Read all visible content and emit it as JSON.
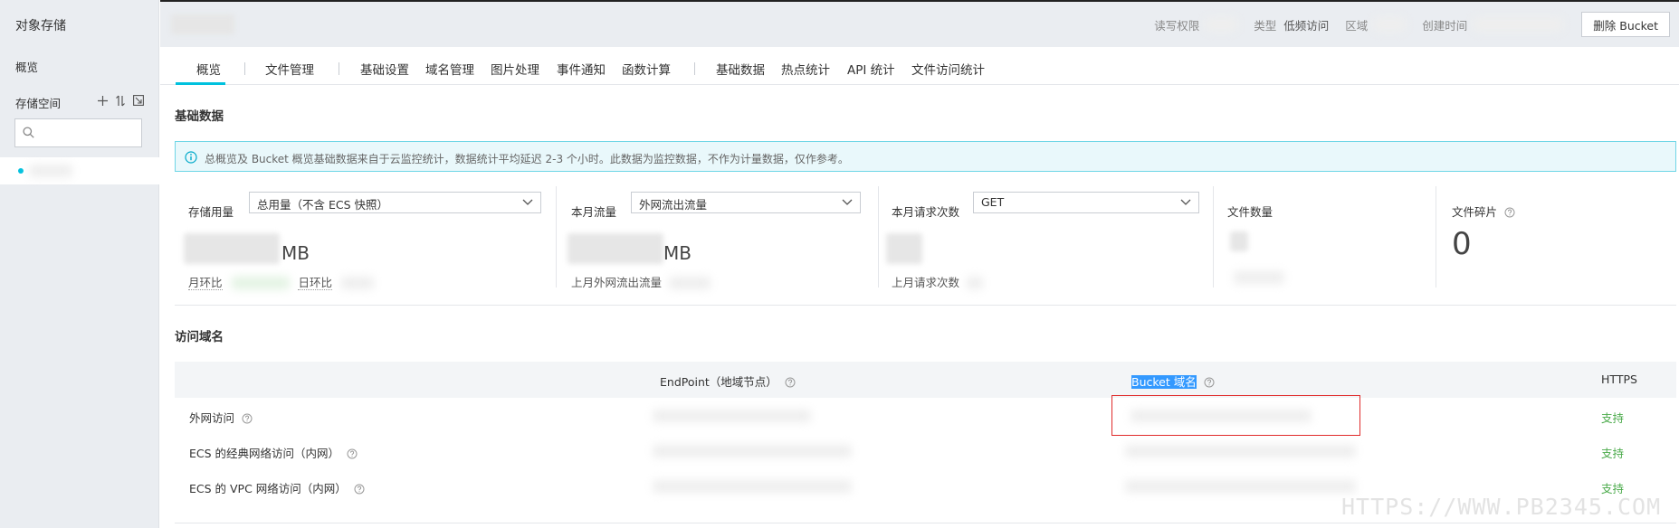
{
  "sidebar": {
    "title": "对象存储",
    "overview": "概览",
    "buckets_label": "存储空间",
    "search_placeholder": ""
  },
  "header": {
    "permission_label": "读写权限",
    "type_label": "类型",
    "type_value": "低频访问",
    "region_label": "区域",
    "created_label": "创建时间",
    "delete_button": "删除 Bucket"
  },
  "tabs": [
    {
      "label": "概览"
    },
    {
      "label": "文件管理"
    },
    {
      "label": "基础设置"
    },
    {
      "label": "域名管理"
    },
    {
      "label": "图片处理"
    },
    {
      "label": "事件通知"
    },
    {
      "label": "函数计算"
    },
    {
      "label": "基础数据"
    },
    {
      "label": "热点统计"
    },
    {
      "label": "API 统计"
    },
    {
      "label": "文件访问统计"
    }
  ],
  "basic_data": {
    "title": "基础数据",
    "notice": "总概览及 Bucket 概览基础数据来自于云监控统计，数据统计平均延迟 2-3 个小时。此数据为监控数据，不作为计量数据，仅作参考。",
    "cards": {
      "storage": {
        "label": "存储用量",
        "select": "总用量（不含 ECS 快照）",
        "unit": "MB",
        "mom_label": "月环比",
        "dod_label": "日环比"
      },
      "traffic": {
        "label": "本月流量",
        "select": "外网流出流量",
        "unit": "MB",
        "last_label": "上月外网流出流量"
      },
      "requests": {
        "label": "本月请求次数",
        "select": "GET",
        "last_label": "上月请求次数"
      },
      "files": {
        "label": "文件数量"
      },
      "fragments": {
        "label": "文件碎片",
        "value": "0"
      }
    }
  },
  "domains": {
    "title": "访问域名",
    "columns": {
      "endpoint": "EndPoint（地域节点）",
      "bucket_domain": "Bucket 域名",
      "https": "HTTPS"
    },
    "rows": [
      {
        "label": "外网访问",
        "https": "支持"
      },
      {
        "label": "ECS 的经典网络访问（内网）",
        "https": "支持"
      },
      {
        "label": "ECS 的 VPC 网络访问（内网）",
        "https": "支持"
      }
    ]
  },
  "watermark": "HTTPS://WWW.PB2345.COM",
  "colors": {
    "accent": "#00c1de",
    "success": "#4aaa4a",
    "highlight": "#e02b2b"
  }
}
